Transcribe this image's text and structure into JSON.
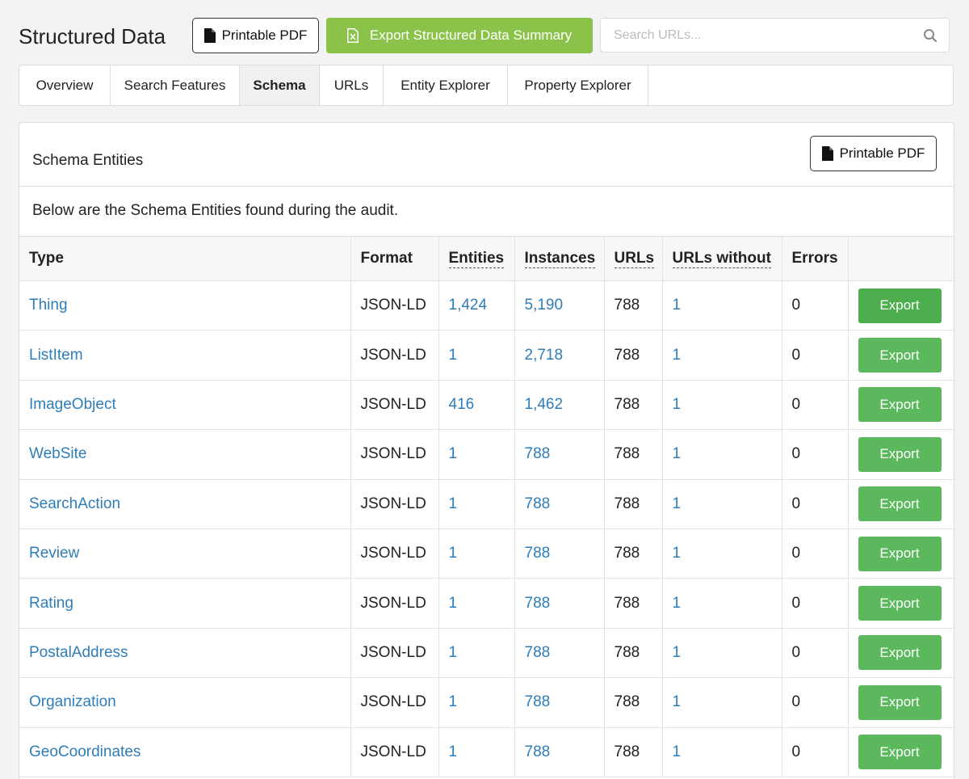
{
  "header": {
    "title": "Structured Data",
    "printable_pdf_label": "Printable PDF",
    "export_summary_label": "Export Structured Data Summary",
    "search_placeholder": "Search URLs..."
  },
  "tabs": [
    {
      "label": "Overview",
      "active": false
    },
    {
      "label": "Search Features",
      "active": false
    },
    {
      "label": "Schema",
      "active": true
    },
    {
      "label": "URLs",
      "active": false
    },
    {
      "label": "Entity Explorer",
      "active": false
    },
    {
      "label": "Property Explorer",
      "active": false
    }
  ],
  "panel": {
    "title": "Schema Entities",
    "printable_pdf_label": "Printable PDF",
    "description": "Below are the Schema Entities found during the audit."
  },
  "table": {
    "columns": [
      "Type",
      "Format",
      "Entities",
      "Instances",
      "URLs",
      "URLs without",
      "Errors",
      ""
    ],
    "export_label": "Export",
    "rows": [
      {
        "type": "Thing",
        "format": "JSON-LD",
        "entities": "1,424",
        "instances": "5,190",
        "urls": "788",
        "urls_without": "1",
        "errors": "0"
      },
      {
        "type": "ListItem",
        "format": "JSON-LD",
        "entities": "1",
        "instances": "2,718",
        "urls": "788",
        "urls_without": "1",
        "errors": "0"
      },
      {
        "type": "ImageObject",
        "format": "JSON-LD",
        "entities": "416",
        "instances": "1,462",
        "urls": "788",
        "urls_without": "1",
        "errors": "0"
      },
      {
        "type": "WebSite",
        "format": "JSON-LD",
        "entities": "1",
        "instances": "788",
        "urls": "788",
        "urls_without": "1",
        "errors": "0"
      },
      {
        "type": "SearchAction",
        "format": "JSON-LD",
        "entities": "1",
        "instances": "788",
        "urls": "788",
        "urls_without": "1",
        "errors": "0"
      },
      {
        "type": "Review",
        "format": "JSON-LD",
        "entities": "1",
        "instances": "788",
        "urls": "788",
        "urls_without": "1",
        "errors": "0"
      },
      {
        "type": "Rating",
        "format": "JSON-LD",
        "entities": "1",
        "instances": "788",
        "urls": "788",
        "urls_without": "1",
        "errors": "0"
      },
      {
        "type": "PostalAddress",
        "format": "JSON-LD",
        "entities": "1",
        "instances": "788",
        "urls": "788",
        "urls_without": "1",
        "errors": "0"
      },
      {
        "type": "Organization",
        "format": "JSON-LD",
        "entities": "1",
        "instances": "788",
        "urls": "788",
        "urls_without": "1",
        "errors": "0"
      },
      {
        "type": "GeoCoordinates",
        "format": "JSON-LD",
        "entities": "1",
        "instances": "788",
        "urls": "788",
        "urls_without": "1",
        "errors": "0"
      }
    ]
  },
  "colors": {
    "accent_green": "#8bc34a",
    "export_green": "#5cb85c",
    "link_blue": "#2e7db9"
  }
}
